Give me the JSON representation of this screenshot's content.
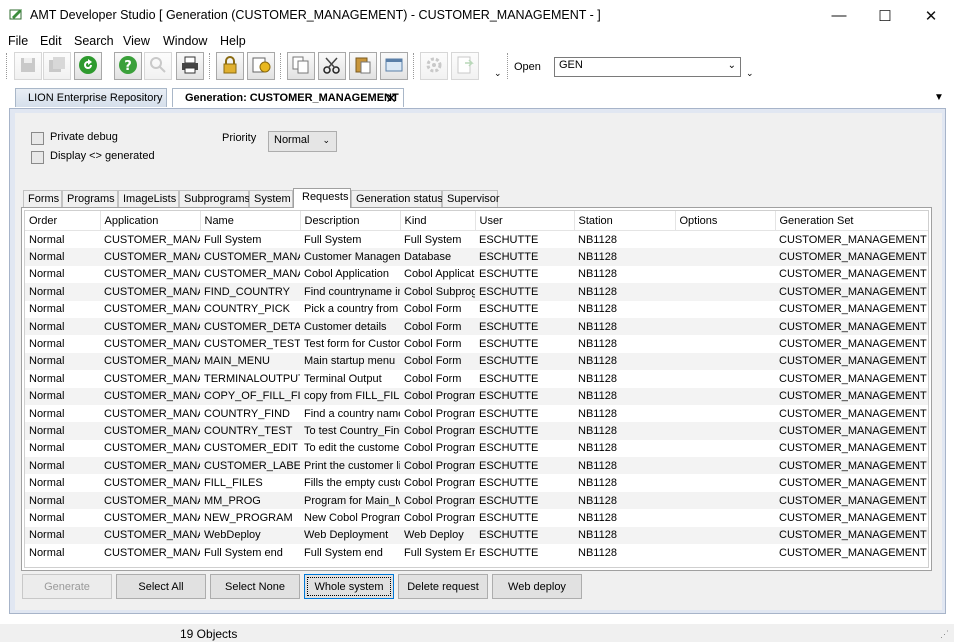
{
  "window": {
    "title": "AMT Developer Studio  [ Generation (CUSTOMER_MANAGEMENT) - CUSTOMER_MANAGEMENT - ]",
    "minimize": "—",
    "maximize": "☐",
    "close": "✕"
  },
  "menu": [
    {
      "label": "File"
    },
    {
      "label": "Edit"
    },
    {
      "label": "Search"
    },
    {
      "label": "View"
    },
    {
      "label": "Window"
    },
    {
      "label": "Help"
    }
  ],
  "toolbar": {
    "open_label": "Open",
    "generation_value": "GEN",
    "chevron": "⌄"
  },
  "doc_tabs": {
    "repository": "LION Enterprise Repository",
    "generation": "Generation: CUSTOMER_MANAGEMENT",
    "close_glyph": "✕"
  },
  "options": {
    "private_debug": "Private debug",
    "display_generated": "Display <> generated",
    "priority_label": "Priority",
    "priority_value": "Normal"
  },
  "tabs": [
    {
      "label": "Forms"
    },
    {
      "label": "Programs"
    },
    {
      "label": "ImageLists"
    },
    {
      "label": "Subprograms"
    },
    {
      "label": "System"
    },
    {
      "label": "Requests"
    },
    {
      "label": "Generation status"
    },
    {
      "label": "Supervisor"
    }
  ],
  "table": {
    "columns": [
      "Order",
      "Application",
      "Name",
      "Description",
      "Kind",
      "User",
      "Station",
      "Options",
      "Generation Set"
    ],
    "rows": [
      [
        "Normal",
        "CUSTOMER_MANA",
        "Full System",
        "Full System",
        "Full System",
        "ESCHUTTE",
        "NB1128",
        "",
        "CUSTOMER_MANAGEMENT"
      ],
      [
        "Normal",
        "CUSTOMER_MANA",
        "CUSTOMER_MANA",
        "Customer Manageme",
        "Database",
        "ESCHUTTE",
        "NB1128",
        "",
        "CUSTOMER_MANAGEMENT"
      ],
      [
        "Normal",
        "CUSTOMER_MANA",
        "CUSTOMER_MANA",
        "Cobol Application",
        "Cobol Applicati",
        "ESCHUTTE",
        "NB1128",
        "",
        "CUSTOMER_MANAGEMENT"
      ],
      [
        "Normal",
        "CUSTOMER_MANA",
        "FIND_COUNTRY",
        "Find countryname in",
        "Cobol Subprog",
        "ESCHUTTE",
        "NB1128",
        "",
        "CUSTOMER_MANAGEMENT"
      ],
      [
        "Normal",
        "CUSTOMER_MANA",
        "COUNTRY_PICK",
        "Pick a country from tl",
        "Cobol Form",
        "ESCHUTTE",
        "NB1128",
        "",
        "CUSTOMER_MANAGEMENT"
      ],
      [
        "Normal",
        "CUSTOMER_MANA",
        "CUSTOMER_DETAI",
        "Customer details",
        "Cobol Form",
        "ESCHUTTE",
        "NB1128",
        "",
        "CUSTOMER_MANAGEMENT"
      ],
      [
        "Normal",
        "CUSTOMER_MANA",
        "CUSTOMER_TEST",
        "Test form for Custom",
        "Cobol Form",
        "ESCHUTTE",
        "NB1128",
        "",
        "CUSTOMER_MANAGEMENT"
      ],
      [
        "Normal",
        "CUSTOMER_MANA",
        "MAIN_MENU",
        "Main startup menu",
        "Cobol Form",
        "ESCHUTTE",
        "NB1128",
        "",
        "CUSTOMER_MANAGEMENT"
      ],
      [
        "Normal",
        "CUSTOMER_MANA",
        "TERMINALOUTPUT",
        "Terminal Output",
        "Cobol Form",
        "ESCHUTTE",
        "NB1128",
        "",
        "CUSTOMER_MANAGEMENT"
      ],
      [
        "Normal",
        "CUSTOMER_MANA",
        "COPY_OF_FILL_FIL",
        "copy from FILL_FILE",
        "Cobol Program",
        "ESCHUTTE",
        "NB1128",
        "",
        "CUSTOMER_MANAGEMENT"
      ],
      [
        "Normal",
        "CUSTOMER_MANA",
        "COUNTRY_FIND",
        "Find a country name",
        "Cobol Program",
        "ESCHUTTE",
        "NB1128",
        "",
        "CUSTOMER_MANAGEMENT"
      ],
      [
        "Normal",
        "CUSTOMER_MANA",
        "COUNTRY_TEST",
        "To test Country_Find",
        "Cobol Program",
        "ESCHUTTE",
        "NB1128",
        "",
        "CUSTOMER_MANAGEMENT"
      ],
      [
        "Normal",
        "CUSTOMER_MANA",
        "CUSTOMER_EDIT",
        "To edit the customer",
        "Cobol Program",
        "ESCHUTTE",
        "NB1128",
        "",
        "CUSTOMER_MANAGEMENT"
      ],
      [
        "Normal",
        "CUSTOMER_MANA",
        "CUSTOMER_LABEL",
        "Print the customer lis",
        "Cobol Program",
        "ESCHUTTE",
        "NB1128",
        "",
        "CUSTOMER_MANAGEMENT"
      ],
      [
        "Normal",
        "CUSTOMER_MANA",
        "FILL_FILES",
        "Fills the empty custo",
        "Cobol Program",
        "ESCHUTTE",
        "NB1128",
        "",
        "CUSTOMER_MANAGEMENT"
      ],
      [
        "Normal",
        "CUSTOMER_MANA",
        "MM_PROG",
        "Program for Main_M",
        "Cobol Program",
        "ESCHUTTE",
        "NB1128",
        "",
        "CUSTOMER_MANAGEMENT"
      ],
      [
        "Normal",
        "CUSTOMER_MANA",
        "NEW_PROGRAM",
        "New Cobol Program",
        "Cobol Program",
        "ESCHUTTE",
        "NB1128",
        "",
        "CUSTOMER_MANAGEMENT"
      ],
      [
        "Normal",
        "CUSTOMER_MANA",
        "WebDeploy",
        "Web Deployment",
        "Web Deploy",
        "ESCHUTTE",
        "NB1128",
        "",
        "CUSTOMER_MANAGEMENT"
      ],
      [
        "Normal",
        "CUSTOMER_MANA",
        "Full System end",
        "Full System end",
        "Full System En",
        "ESCHUTTE",
        "NB1128",
        "",
        "CUSTOMER_MANAGEMENT"
      ]
    ]
  },
  "buttons": {
    "generate": "Generate",
    "select_all": "Select All",
    "select_none": "Select None",
    "whole_system": "Whole system",
    "delete_request": "Delete request",
    "web_deploy": "Web deploy"
  },
  "status": {
    "text": "19 Objects"
  },
  "icons": [
    "app-icon",
    "save-icon",
    "save-all-icon",
    "refresh-icon",
    "help-icon",
    "find-icon",
    "print-icon",
    "lock-icon",
    "properties-icon",
    "copy-icon",
    "cut-icon",
    "paste-icon",
    "window-icon",
    "settings-icon",
    "export-pdf-icon"
  ]
}
